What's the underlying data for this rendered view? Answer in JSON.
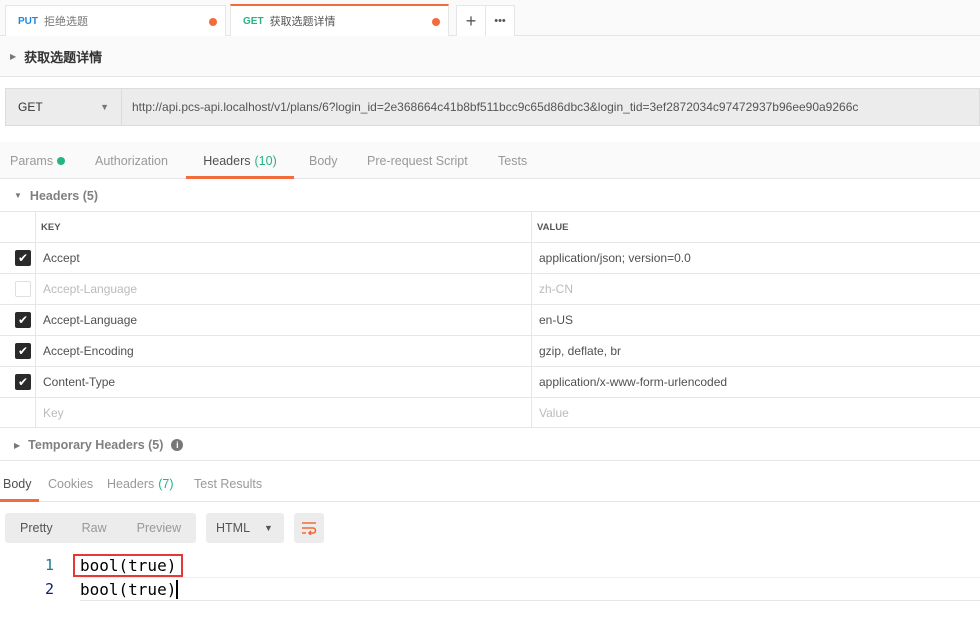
{
  "tabs": [
    {
      "method": "PUT",
      "title": "拒绝选题",
      "color": "#1e88e5"
    },
    {
      "method": "GET",
      "title": "获取选题详情",
      "color": "#26b47f"
    }
  ],
  "new_tab_icon": "+",
  "more_icon": "•••",
  "request_title": "获取选题详情",
  "method": "GET",
  "url": "http://api.pcs-api.localhost/v1/plans/6?login_id=2e368664c41b8bf511bcc9c65d86dbc3&login_tid=3ef2872034c97472937b96ee90a9266c",
  "request_tabs": {
    "params": "Params",
    "authorization": "Authorization",
    "headers": "Headers",
    "headers_count": "(10)",
    "body": "Body",
    "prerequest": "Pre-request Script",
    "tests": "Tests"
  },
  "headers_section": "Headers (5)",
  "columns": {
    "key": "KEY",
    "value": "VALUE"
  },
  "headers": [
    {
      "checked": true,
      "key": "Accept",
      "value": "application/json; version=0.0"
    },
    {
      "checked": false,
      "key": "Accept-Language",
      "value": "zh-CN"
    },
    {
      "checked": true,
      "key": "Accept-Language",
      "value": "en-US"
    },
    {
      "checked": true,
      "key": "Accept-Encoding",
      "value": "gzip, deflate, br"
    },
    {
      "checked": true,
      "key": "Content-Type",
      "value": "application/x-www-form-urlencoded"
    }
  ],
  "placeholder": {
    "key": "Key",
    "value": "Value"
  },
  "temporary_headers": "Temporary Headers (5)",
  "response_tabs": {
    "body": "Body",
    "cookies": "Cookies",
    "headers": "Headers",
    "headers_count": "(7)",
    "test_results": "Test Results"
  },
  "view_modes": {
    "pretty": "Pretty",
    "raw": "Raw",
    "preview": "Preview"
  },
  "format": "HTML",
  "code_lines": [
    {
      "n": "1",
      "text": "bool(true)"
    },
    {
      "n": "2",
      "text": "bool(true)"
    }
  ]
}
